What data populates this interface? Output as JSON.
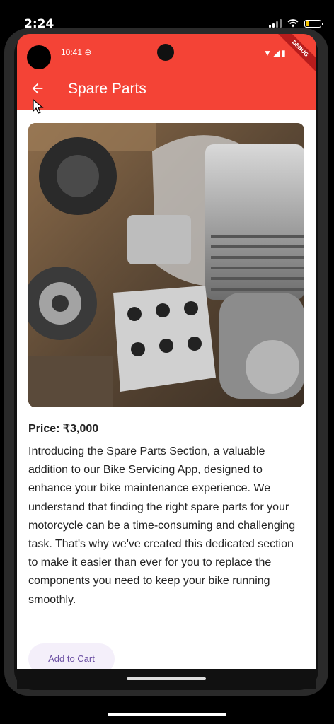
{
  "ios_status": {
    "time": "2:24"
  },
  "android_status": {
    "time": "10:41",
    "icons": "▼◢▮",
    "debug_label": "DEBUG"
  },
  "appbar": {
    "title": "Spare Parts",
    "back_icon": "arrow-left-icon"
  },
  "product": {
    "price": "Price: ₹3,000",
    "description": "Introducing the Spare Parts Section, a valuable addition to our Bike Servicing App, designed to enhance your bike maintenance experience. We understand that finding the right spare parts for your motorcycle can be a time-consuming and challenging task. That's why we've created this dedicated section to make it easier than ever for you to replace the components you need to keep your bike running smoothly.",
    "add_to_cart_label": "Add to Cart"
  },
  "colors": {
    "appbar": "#f44336",
    "accent": "#6b4fa3",
    "battery": "#f5c400"
  }
}
